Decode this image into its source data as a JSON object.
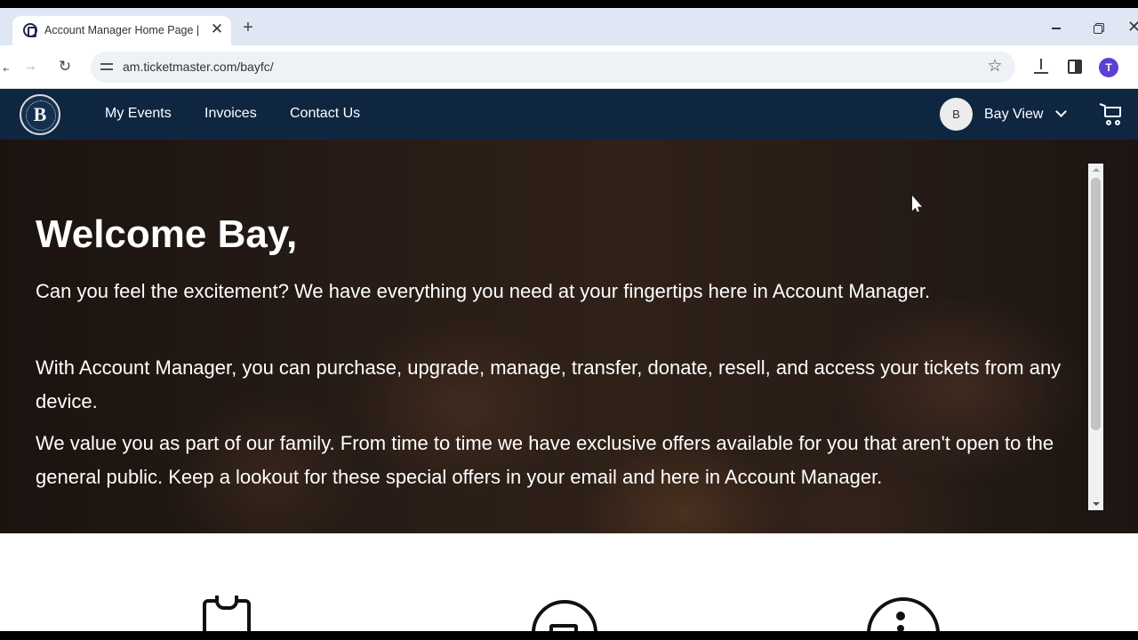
{
  "browser": {
    "tab_title": "Account Manager Home Page |",
    "url": "am.ticketmaster.com/bayfc/",
    "profile_initial": "T"
  },
  "nav": {
    "logo_letter": "B",
    "links": [
      "My Events",
      "Invoices",
      "Contact Us"
    ],
    "user_initial": "B",
    "user_name": "Bay View"
  },
  "hero": {
    "title": "Welcome Bay,",
    "paragraphs": [
      "Can you feel the excitement? We have everything you need at your fingertips here in Account Manager.",
      "With Account Manager, you can purchase, upgrade, manage, transfer, donate, resell, and access your tickets from any device.",
      "We value you as part of our family. From time to time we have exclusive offers available for you that aren't open to the general public. Keep a lookout for these special offers in your email and here in Account Manager."
    ]
  },
  "feature_icons": [
    "jersey-icon",
    "ticket-icon",
    "info-icon"
  ],
  "colors": {
    "nav_background": "#0f2641",
    "tab_strip": "#dfe7f5",
    "profile": "#5d3fd3"
  }
}
